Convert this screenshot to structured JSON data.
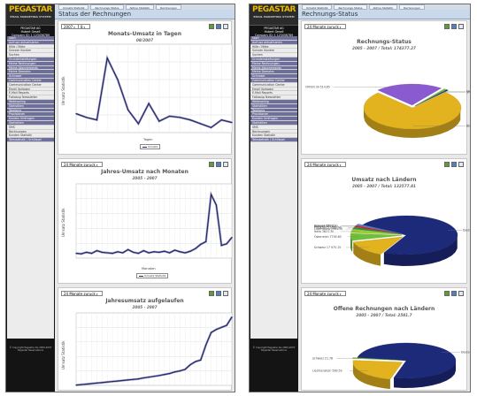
{
  "left": {
    "logo": {
      "title": "PEGASTAR",
      "subtitle": "EMAIL MARKETING SYSTEM"
    },
    "user": [
      "PEGASTAR AG",
      "Hubert Gesell",
      "Company ID: 1 123456789"
    ],
    "menu": [
      {
        "label": "Start",
        "hdr": true
      },
      {
        "label": "Aufruse aktualisieren",
        "hdr": true
      },
      {
        "label": "Hilfe / Mitte",
        "hdr": false
      },
      {
        "label": "Suicsen Kunden",
        "hdr": false
      },
      {
        "label": "Suchen",
        "hdr": false
      },
      {
        "label": "Grundeinstellungen",
        "hdr": true
      },
      {
        "label": "Meine Rechnungen",
        "hdr": true
      },
      {
        "label": "Meine Abonnements",
        "hdr": true
      },
      {
        "label": "Meine Domains",
        "hdr": true
      },
      {
        "label": "Schnaser",
        "hdr": true
      },
      {
        "label": "Communication Center",
        "hdr": true
      },
      {
        "label": "Communication Center",
        "hdr": false
      },
      {
        "label": "Email Vorlagen",
        "hdr": false
      },
      {
        "label": "E-Mail Reports",
        "hdr": false
      },
      {
        "label": "Followup Newsletter",
        "hdr": false
      },
      {
        "label": "Webhosting",
        "hdr": true
      },
      {
        "label": "Statistiken",
        "hdr": true
      },
      {
        "label": "Telefonie",
        "hdr": true
      },
      {
        "label": "Provisionen",
        "hdr": true
      },
      {
        "label": "Kunden Umfragen",
        "hdr": true
      },
      {
        "label": "Statistiken",
        "hdr": true
      },
      {
        "label": "SMS",
        "hdr": false
      },
      {
        "label": "Rechnungen",
        "hdr": false
      },
      {
        "label": "Kunden Statistik",
        "hdr": false
      },
      {
        "label": "Telestatistik / Schlüssel",
        "hdr": true
      }
    ],
    "copyright": "© Copyright Pegastar AG 2000-2007 Pegastar Reservations",
    "tabs": [
      "Umsatz Statistik",
      "Rechnungs Status",
      "Aktive Statistik",
      "Rechnungen"
    ],
    "title": "Status der Rechnungen",
    "controls": {
      "year": "2007",
      "month": "8",
      "range2": "24 Monate zuruck",
      "range3": "24 Monate zuruck"
    },
    "panel1": {
      "title": "Monats-Umsatz in Tagen",
      "subtitle": "08/2007",
      "xlabel": "Tagen",
      "ylabel": "Umsatz Statistik",
      "legend": "Umsatz"
    },
    "panel2": {
      "title": "Jahres-Umsatz nach Monaten",
      "subtitle": "2005 - 2007",
      "xlabel": "Monaten",
      "ylabel": "Umsatz Statistik",
      "legend": "Umsatz Statistik"
    },
    "panel3": {
      "title": "Jahresumsatz aufgelaufen",
      "subtitle": "2005 - 2007",
      "ylabel": "Umsatz Statistik"
    }
  },
  "right": {
    "logo": {
      "title": "PEGASTAR",
      "subtitle": "EMAIL MARKETING SYSTEM"
    },
    "user": [
      "PEGASTAR AG",
      "Hubert Gesell",
      "Company ID: 1 123456789"
    ],
    "menu": [
      {
        "label": "Start",
        "hdr": true
      },
      {
        "label": "Aufruse aktualisieren",
        "hdr": true
      },
      {
        "label": "Hilfe / Mitte",
        "hdr": false
      },
      {
        "label": "Suicsen Kunden",
        "hdr": false
      },
      {
        "label": "Suchen",
        "hdr": false
      },
      {
        "label": "Grundeinstellungen",
        "hdr": true
      },
      {
        "label": "Meine Rechnungen",
        "hdr": true
      },
      {
        "label": "Meine Abonnements",
        "hdr": true
      },
      {
        "label": "Meine Domains",
        "hdr": true
      },
      {
        "label": "Schnaser",
        "hdr": true
      },
      {
        "label": "Communication Center",
        "hdr": true
      },
      {
        "label": "Communication Center",
        "hdr": false
      },
      {
        "label": "Email Vorlagen",
        "hdr": false
      },
      {
        "label": "E-Mail Reports",
        "hdr": false
      },
      {
        "label": "Followup Newsletter",
        "hdr": false
      },
      {
        "label": "Webhosting",
        "hdr": true
      },
      {
        "label": "Statistiken",
        "hdr": true
      },
      {
        "label": "Telefonie",
        "hdr": true
      },
      {
        "label": "Provisionen",
        "hdr": true
      },
      {
        "label": "Kunden Umfragen",
        "hdr": true
      },
      {
        "label": "Statistiken",
        "hdr": true
      },
      {
        "label": "SMS",
        "hdr": false
      },
      {
        "label": "Rechnungen",
        "hdr": false
      },
      {
        "label": "Kunden Statistik",
        "hdr": false
      },
      {
        "label": "Telestatistik / Schlüssel",
        "hdr": true
      }
    ],
    "copyright": "© Copyright Pegastar AG 2000-2007 Pegastar Reservations",
    "tabs": [
      "Umsatz Statistik",
      "Rechnungs Status",
      "Aktive Statistik",
      "Rechnungen"
    ],
    "title": "Rechnungs-Status",
    "controls": {
      "range1": "24 Monate zuruck",
      "range2": "24 Monate zuruck",
      "range3": "24 Monate zuruck"
    },
    "panel1": {
      "title": "Rechnungs-Status",
      "subtitle": "2005 - 2007 / Total: 174377.27"
    },
    "panel2": {
      "title": "Umsatz nach Ländern",
      "subtitle": "2005 - 2007 / Total: 132577.81"
    },
    "panel3": {
      "title": "Offene Rechnungen nach Ländern",
      "subtitle": "2005 - 2007 / Total: 2581.7"
    }
  },
  "chart_data": [
    {
      "type": "line",
      "title": "Monats-Umsatz in Tagen",
      "subtitle": "08/2007",
      "xlabel": "Tagen",
      "ylabel": "Umsatz Statistik",
      "series": [
        {
          "name": "Umsatz",
          "values": [
            1500,
            1200,
            1000,
            5900,
            4200,
            1800,
            700,
            2300,
            900,
            1300,
            1200,
            1000,
            700,
            400,
            1000,
            800
          ]
        }
      ],
      "ylim": [
        0,
        7000
      ],
      "grid": true
    },
    {
      "type": "line",
      "title": "Jahres-Umsatz nach Monaten",
      "subtitle": "2005 - 2007",
      "xlabel": "Monaten",
      "ylabel": "Umsatz Statistik",
      "series": [
        {
          "name": "Umsatz Statistik",
          "values": [
            900,
            800,
            1100,
            900,
            1400,
            1100,
            1000,
            900,
            1200,
            1000,
            1600,
            1100,
            900,
            1400,
            1000,
            1200,
            1100,
            1300,
            1000,
            1500,
            1200,
            1000,
            1300,
            1800,
            2600,
            3100,
            12000,
            10000,
            2400,
            2700,
            3900
          ]
        }
      ],
      "ylim": [
        0,
        14000
      ],
      "grid": true
    },
    {
      "type": "line",
      "title": "Jahresumsatz aufgelaufen",
      "subtitle": "2005 - 2007",
      "ylabel": "Umsatz Statistik",
      "series": [
        {
          "name": "Umsatz Statistik",
          "values": [
            500,
            1500,
            2500,
            3500,
            4500,
            5500,
            6500,
            7500,
            8500,
            9500,
            10500,
            11500,
            12500,
            14500,
            16000,
            17500,
            19000,
            21000,
            23000,
            26000,
            28000,
            31000,
            40000,
            46000,
            49000,
            78000,
            102000,
            108000,
            112000,
            116000,
            132000
          ]
        }
      ],
      "ylim": [
        0,
        140000
      ],
      "grid": true
    },
    {
      "type": "pie",
      "title": "Rechnungs-Status",
      "subtitle": "2005 - 2007 / Total: 174377.27",
      "series": [
        {
          "name": "Rechnungs-Status",
          "values": [
            132080.54,
            39514.65,
            1744.84,
            1037.24
          ]
        }
      ],
      "categories": [
        "BEZAHLT 132 080.54",
        "OFFEN 39 514.65",
        "GEMAHNT 1744.84",
        "STORNIERT 1037.24"
      ],
      "colors": [
        "#e2b21f",
        "#8a5bd0",
        "#6fbf3a",
        "#1d2a7a"
      ]
    },
    {
      "type": "pie",
      "title": "Umsatz nach Ländern",
      "subtitle": "2005 - 2007 / Total: 132577.81",
      "categories": [
        "Deutschland 97 624.78",
        "Schweiz 17 975.15",
        "Österreich 7795.60",
        "Italia 3821.30",
        "Luxemburg 1964.50",
        "Frankreich 1650.00",
        "Spanien 1076.95",
        "Holland 669.53"
      ],
      "series": [
        {
          "name": "Umsatz",
          "values": [
            97624.78,
            17975.15,
            7795.6,
            3821.3,
            1964.5,
            1650.0,
            1076.95,
            669.53
          ]
        }
      ],
      "colors": [
        "#1d2a7a",
        "#e2b21f",
        "#6fbf3a",
        "#9acd32",
        "#2f8f2f",
        "#c42020",
        "#8a5bd0",
        "#40a0d0"
      ]
    },
    {
      "type": "pie",
      "title": "Offene Rechnungen nach Ländern",
      "subtitle": "2005 - 2007 / Total: 2581.7",
      "categories": [
        "Deutschland 1 991.98",
        "Liechtenstein 589.59",
        "Schweiz 21.78"
      ],
      "series": [
        {
          "name": "Offene Rechnungen",
          "values": [
            1991.98,
            589.59,
            21.78
          ]
        }
      ],
      "colors": [
        "#1d2a7a",
        "#e2b21f",
        "#6fbf3a"
      ]
    }
  ]
}
